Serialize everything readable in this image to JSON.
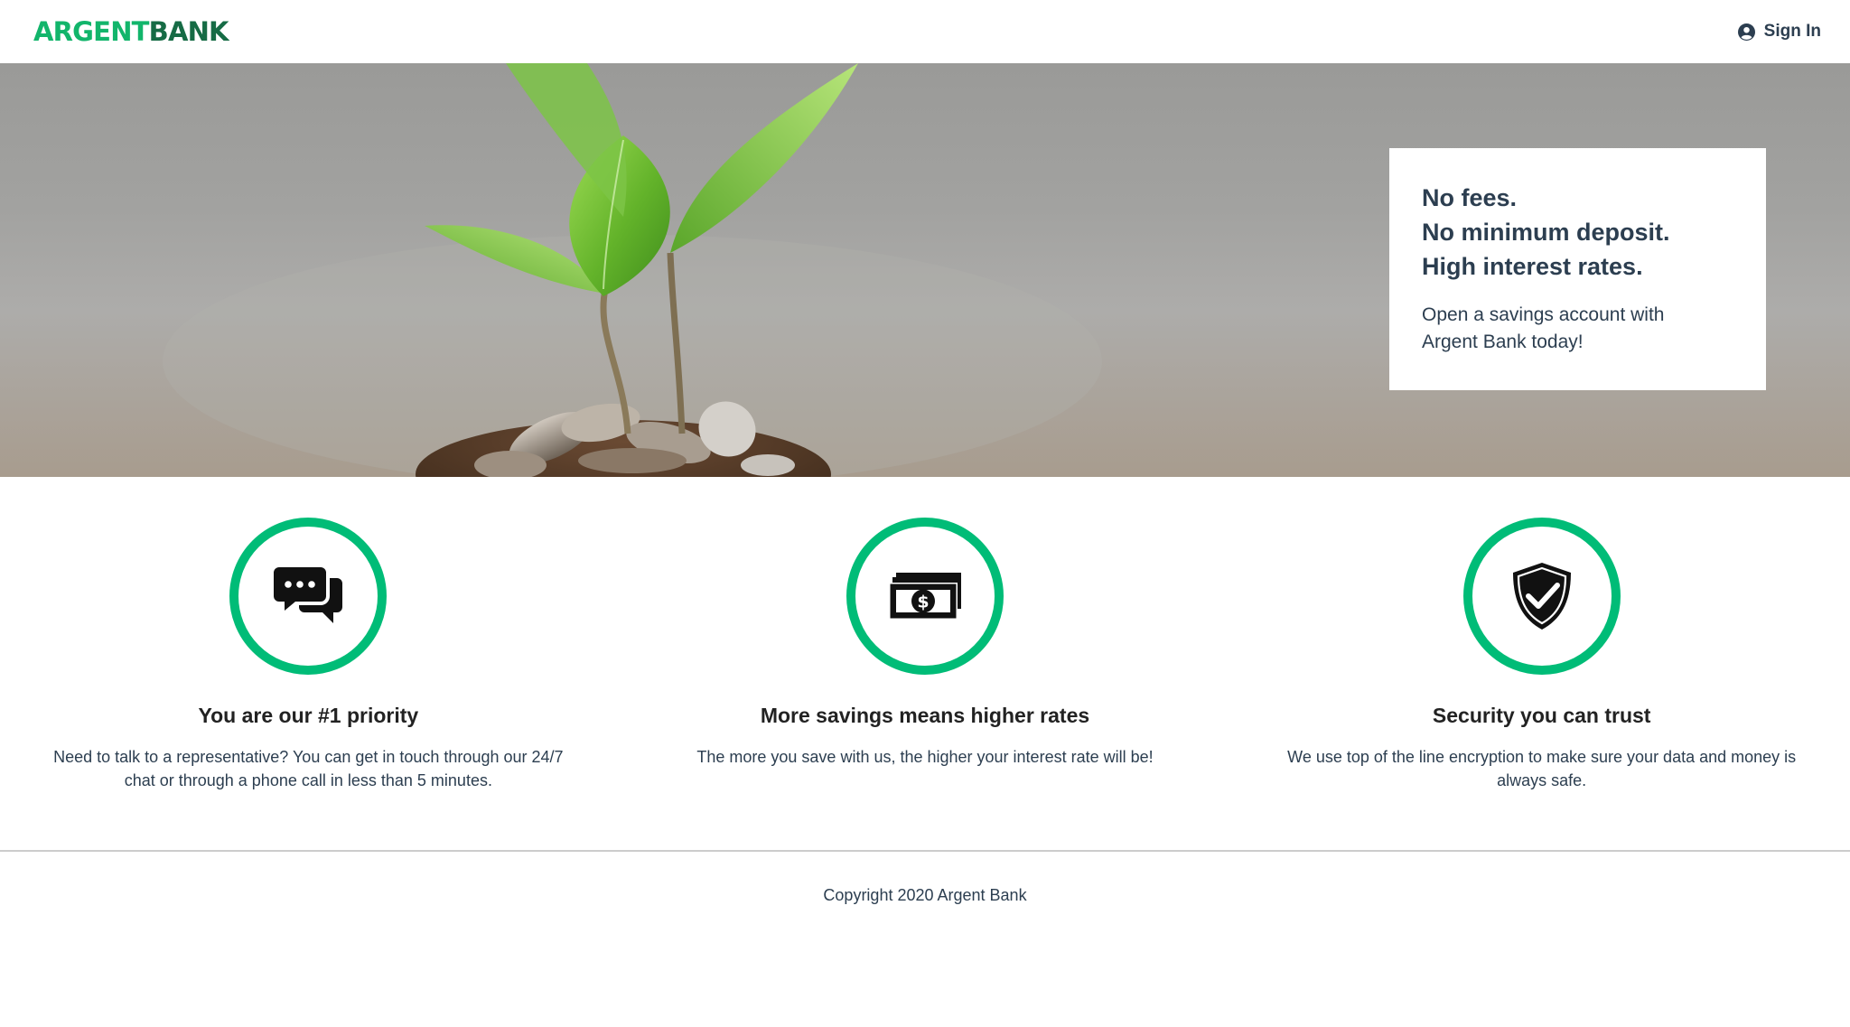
{
  "nav": {
    "logo_part1": "ARGENT",
    "logo_part2": "BANK",
    "signin_icon": "user-circle-icon",
    "signin_label": "Sign In"
  },
  "hero": {
    "image": "plant-growing-from-coins",
    "promo": {
      "line1": "No fees.",
      "line2": "No minimum deposit.",
      "line3": "High interest rates.",
      "text": "Open a savings account with Argent Bank today!"
    }
  },
  "features": [
    {
      "icon": "chat-icon",
      "title": "You are our #1 priority",
      "text": "Need to talk to a representative? You can get in touch through our 24/7 chat or through a phone call in less than 5 minutes."
    },
    {
      "icon": "money-icon",
      "title": "More savings means higher rates",
      "text": "The more you save with us, the higher your interest rate will be!"
    },
    {
      "icon": "security-shield-icon",
      "title": "Security you can trust",
      "text": "We use top of the line encryption to make sure your data and money is always safe."
    }
  ],
  "footer": {
    "copyright": "Copyright 2020 Argent Bank"
  },
  "colors": {
    "accent": "#00bc77",
    "logo_light": "#12b56b",
    "logo_dark": "#166b45",
    "text": "#2c3e50"
  }
}
